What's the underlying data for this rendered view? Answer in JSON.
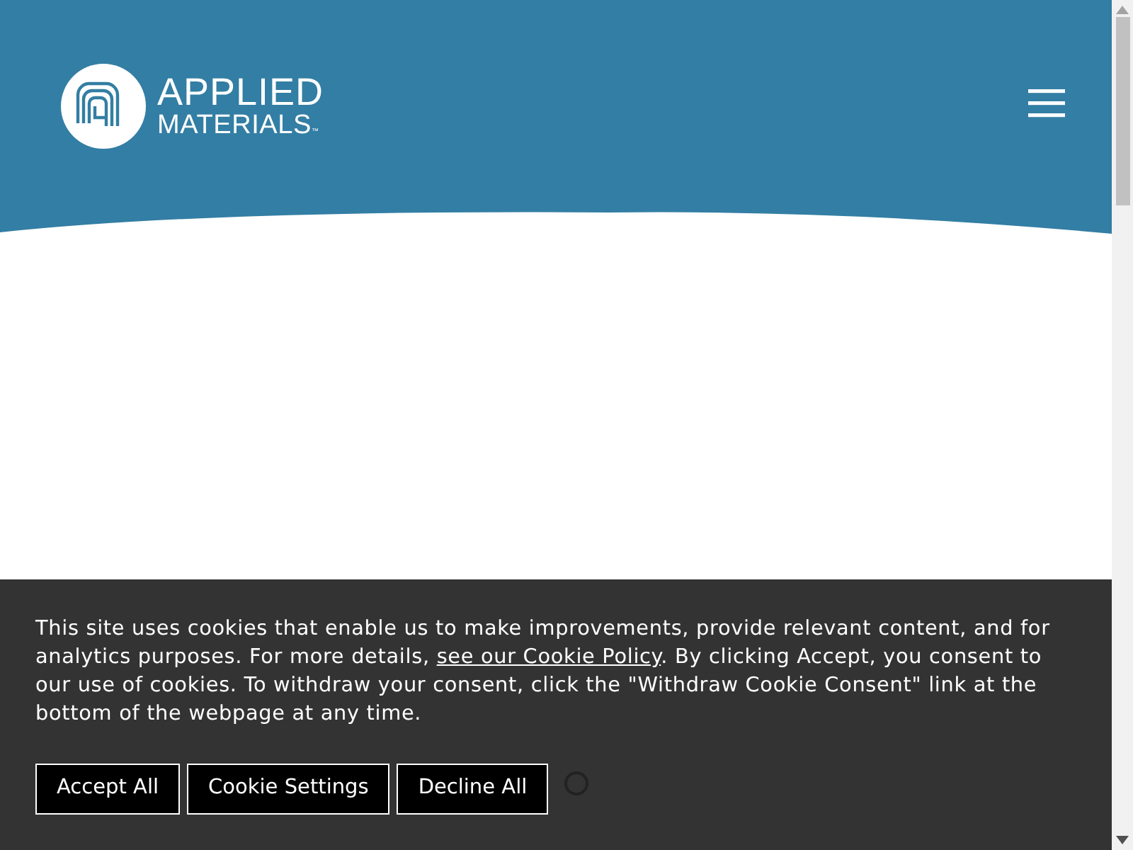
{
  "header": {
    "logo": {
      "line_1": "APPLIED",
      "line_2": "MATERIALS",
      "mark": "™"
    }
  },
  "cookie_banner": {
    "message": "This site uses cookies that enable us to make improvements, provide relevant content, and for analytics purposes. For more details, ",
    "link": "see our Cookie Policy",
    "message_end": ". By clicking Accept, you consent to our use of cookies. To withdraw your consent, click the \"Withdraw Cookie Consent\" link at the bottom of the webpage at any time.",
    "buttons": [
      "Accept All",
      "Cookie Settings",
      "Decline All"
    ]
  }
}
